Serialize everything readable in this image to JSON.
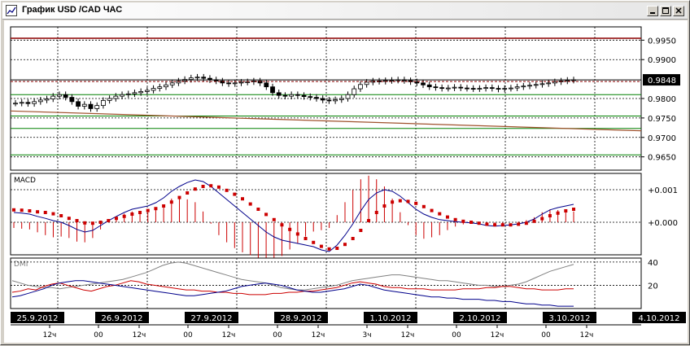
{
  "window": {
    "title": "График USD /CAD  ЧАС",
    "icon": "chart-app-icon",
    "controls": [
      "minimize-icon",
      "maximize-icon",
      "close-icon"
    ]
  },
  "colors": {
    "grid": "#000000",
    "bid_line": "#000000",
    "resistance": "#8b0000",
    "support": "#008000",
    "trend": "#a0522d",
    "macd_line": "#00008b",
    "signal_dots": "#cc0000",
    "histogram": "#cc0000",
    "dmi_adx": "#808080",
    "dmi_plus": "#cc0000",
    "dmi_minus": "#00008b"
  },
  "chart_data": [
    {
      "type": "candlestick",
      "price_labels": [
        "0.9950",
        "0.9900",
        "0.9800",
        "0.9750",
        "0.9700",
        "0.9650"
      ],
      "current_price": "0.9848",
      "ylim": [
        0.962,
        0.998
      ],
      "levels": {
        "resistance": [
          0.9955
        ],
        "support": [
          0.981,
          0.9755,
          0.9723,
          0.9655
        ],
        "bid": 0.9848
      },
      "trendline": {
        "from": 0.9768,
        "to": 0.9717
      },
      "closes": [
        0.9788,
        0.979,
        0.9787,
        0.9792,
        0.9796,
        0.9799,
        0.9806,
        0.981,
        0.9803,
        0.9792,
        0.978,
        0.9785,
        0.9774,
        0.9782,
        0.9795,
        0.98,
        0.9806,
        0.981,
        0.9812,
        0.9815,
        0.9818,
        0.9821,
        0.9826,
        0.983,
        0.9835,
        0.984,
        0.9845,
        0.9849,
        0.9853,
        0.9855,
        0.9852,
        0.9848,
        0.9845,
        0.984,
        0.9838,
        0.984,
        0.9842,
        0.9843,
        0.9845,
        0.984,
        0.983,
        0.9815,
        0.9808,
        0.9806,
        0.981,
        0.9808,
        0.9805,
        0.9803,
        0.98,
        0.9796,
        0.9794,
        0.9797,
        0.98,
        0.981,
        0.9825,
        0.9836,
        0.9842,
        0.9845,
        0.9844,
        0.9846,
        0.9847,
        0.9848,
        0.9846,
        0.9843,
        0.984,
        0.9835,
        0.983,
        0.9828,
        0.9826,
        0.9827,
        0.9829,
        0.9827,
        0.9826,
        0.9825,
        0.9826,
        0.9828,
        0.9826,
        0.9824,
        0.9826,
        0.9827,
        0.983,
        0.9832,
        0.9834,
        0.9836,
        0.9838,
        0.984,
        0.9843,
        0.9845,
        0.9847,
        0.9848
      ]
    },
    {
      "type": "line",
      "label": "MACD",
      "tick_labels": [
        "+0.001",
        "+0.000"
      ],
      "ylim": [
        -0.0009,
        0.0014
      ],
      "macd": [
        0.0003,
        0.00028,
        0.00025,
        0.00018,
        0.00012,
        5e-05,
        0.0,
        -0.0001,
        -0.00022,
        -0.0003,
        -0.00025,
        -0.0001,
        5e-05,
        0.00018,
        0.0003,
        0.0004,
        0.00045,
        0.0005,
        0.0006,
        0.00075,
        0.00095,
        0.0011,
        0.00122,
        0.0013,
        0.00125,
        0.0011,
        0.0009,
        0.0007,
        0.0005,
        0.0003,
        0.0001,
        -0.0001,
        -0.0003,
        -0.00045,
        -0.00055,
        -0.0006,
        -0.00065,
        -0.0007,
        -0.00075,
        -0.00085,
        -0.0009,
        -0.0007,
        -0.0004,
        -5e-05,
        0.00035,
        0.0007,
        0.0009,
        0.001,
        0.00095,
        0.0008,
        0.0006,
        0.0004,
        0.00025,
        0.00015,
        8e-05,
        5e-05,
        2e-05,
        0.0,
        -2e-05,
        -5e-05,
        -0.0001,
        -0.00012,
        -0.0001,
        -8e-05,
        -5e-05,
        0.0,
        0.0001,
        0.00025,
        0.00038,
        0.00045,
        0.0005,
        0.00055
      ],
      "signal": [
        0.00038,
        0.00037,
        0.00035,
        0.00032,
        0.0003,
        0.00026,
        0.0002,
        0.00012,
        5e-05,
        -2e-05,
        -3e-05,
        0.0,
        5e-05,
        0.00012,
        0.00018,
        0.00025,
        0.0003,
        0.00036,
        0.00042,
        0.0005,
        0.00062,
        0.00076,
        0.0009,
        0.00102,
        0.0011,
        0.00112,
        0.00108,
        0.00098,
        0.00086,
        0.00072,
        0.00056,
        0.0004,
        0.00024,
        8e-05,
        -8e-05,
        -0.00022,
        -0.00036,
        -0.0005,
        -0.00062,
        -0.00074,
        -0.00082,
        -0.0008,
        -0.00068,
        -0.0005,
        -0.00025,
        5e-05,
        0.0003,
        0.0005,
        0.00062,
        0.00066,
        0.00064,
        0.00058,
        0.00048,
        0.00036,
        0.00026,
        0.00016,
        8e-05,
        3e-05,
        0.0,
        -3e-05,
        -6e-05,
        -8e-05,
        -8e-05,
        -8e-05,
        -6e-05,
        -3e-05,
        3e-05,
        0.00011,
        0.0002,
        0.00028,
        0.00035,
        0.0004
      ]
    },
    {
      "type": "line",
      "label": "DMI",
      "tick_labels": [
        "40",
        "20"
      ],
      "ylim": [
        0,
        42
      ],
      "adx": [
        24,
        22,
        20,
        19,
        18,
        18,
        17,
        18,
        19,
        20,
        21,
        22,
        23,
        24,
        25,
        27,
        29,
        31,
        34,
        37,
        39,
        40,
        39,
        37,
        35,
        33,
        31,
        29,
        27,
        25,
        24,
        23,
        22,
        20,
        18,
        17,
        16,
        16,
        17,
        18,
        19,
        20,
        22,
        24,
        25,
        26,
        27,
        28,
        29,
        29,
        28,
        27,
        26,
        25,
        24,
        24,
        23,
        22,
        21,
        20,
        20,
        19,
        19,
        20,
        21,
        23,
        26,
        29,
        32,
        34,
        36,
        38
      ],
      "plus_di": [
        14,
        15,
        17,
        16,
        19,
        21,
        22,
        20,
        18,
        16,
        15,
        17,
        19,
        20,
        22,
        24,
        23,
        21,
        20,
        19,
        18,
        17,
        16,
        16,
        15,
        15,
        14,
        14,
        13,
        13,
        12,
        12,
        12,
        13,
        13,
        14,
        14,
        15,
        15,
        16,
        17,
        18,
        20,
        22,
        23,
        22,
        21,
        19,
        18,
        18,
        17,
        17,
        17,
        16,
        16,
        16,
        16,
        17,
        17,
        17,
        18,
        18,
        19,
        19,
        18,
        17,
        17,
        16,
        16,
        16,
        17,
        17
      ],
      "minus_di": [
        10,
        11,
        13,
        15,
        17,
        20,
        22,
        23,
        24,
        24,
        23,
        22,
        21,
        20,
        19,
        18,
        17,
        16,
        15,
        14,
        13,
        12,
        11,
        11,
        12,
        13,
        14,
        15,
        17,
        19,
        20,
        21,
        22,
        21,
        20,
        18,
        16,
        15,
        14,
        14,
        15,
        16,
        17,
        19,
        21,
        20,
        18,
        16,
        15,
        14,
        13,
        12,
        11,
        10,
        10,
        9,
        9,
        8,
        8,
        8,
        7,
        7,
        6,
        6,
        5,
        4,
        4,
        3,
        3,
        2,
        2,
        2
      ]
    }
  ],
  "x_axis": {
    "dates": [
      "25.9.2012",
      "26.9.2012",
      "27.9.2012",
      "28.9.2012",
      "1.10.2012",
      "2.10.2012",
      "3.10.2012",
      "4.10.2012"
    ],
    "hour_labels": [
      "12ч",
      "00",
      "12ч",
      "00",
      "12ч",
      "00",
      "12ч",
      "3ч",
      "12ч",
      "00",
      "12ч",
      "00",
      "12ч"
    ]
  }
}
